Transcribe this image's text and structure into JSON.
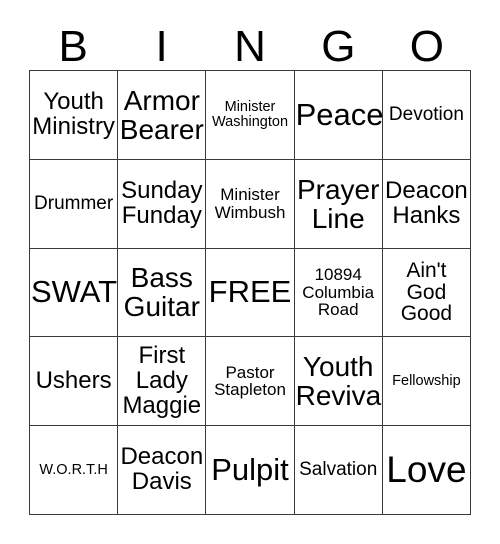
{
  "card": {
    "header_letters": [
      "B",
      "I",
      "N",
      "G",
      "O"
    ],
    "rows": [
      [
        {
          "text": "Youth Ministry",
          "size": "fs-md"
        },
        {
          "text": "Armor Bearer",
          "size": "fs-lg"
        },
        {
          "text": "Minister Washington",
          "size": "fs-tiny"
        },
        {
          "text": "Peace",
          "size": "fs-xl"
        },
        {
          "text": "Devotion",
          "size": "fs-xs"
        }
      ],
      [
        {
          "text": "Drummer",
          "size": "fs-xs"
        },
        {
          "text": "Sunday Funday",
          "size": "fs-md"
        },
        {
          "text": "Minister Wimbush",
          "size": "fs-xxs"
        },
        {
          "text": "Prayer Line",
          "size": "fs-lg"
        },
        {
          "text": "Deacon Hanks",
          "size": "fs-md"
        }
      ],
      [
        {
          "text": "SWAT",
          "size": "fs-xl"
        },
        {
          "text": "Bass Guitar",
          "size": "fs-lg"
        },
        {
          "text": "FREE",
          "size": "fs-xl"
        },
        {
          "text": "10894 Columbia Road",
          "size": "fs-xxs"
        },
        {
          "text": "Ain't God Good",
          "size": "fs-sm"
        }
      ],
      [
        {
          "text": "Ushers",
          "size": "fs-md"
        },
        {
          "text": "First Lady Maggie",
          "size": "fs-md"
        },
        {
          "text": "Pastor Stapleton",
          "size": "fs-xxs"
        },
        {
          "text": "Youth Revival",
          "size": "fs-lg"
        },
        {
          "text": "Fellowship",
          "size": "fs-tiny"
        }
      ],
      [
        {
          "text": "W.O.R.T.H",
          "size": "fs-tiny"
        },
        {
          "text": "Deacon Davis",
          "size": "fs-md"
        },
        {
          "text": "Pulpit",
          "size": "fs-xl"
        },
        {
          "text": "Salvation",
          "size": "fs-xs"
        },
        {
          "text": "Love",
          "size": "fs-xxl"
        }
      ]
    ],
    "free_space_label": "FREE",
    "colors": {
      "background": "#ffffff",
      "text": "#000000",
      "grid_line": "#3a3a3a"
    }
  }
}
